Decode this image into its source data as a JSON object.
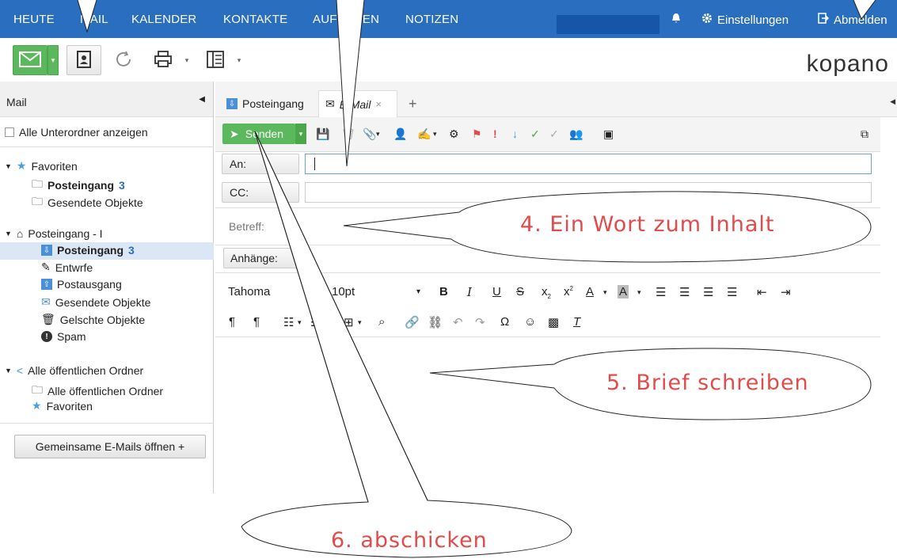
{
  "topnav": {
    "items": [
      "HEUTE",
      "MAIL",
      "KALENDER",
      "KONTAKTE",
      "AUFGABEN",
      "NOTIZEN"
    ],
    "settings_label": "Einstellungen",
    "logout_label": "Abmelden",
    "bg_color": "#2a6ebf"
  },
  "brand": {
    "logo_text": "kopano"
  },
  "leftpanel": {
    "header": "Mail",
    "show_subfolders": "Alle Unterordner anzeigen",
    "favorites_label": "Favoriten",
    "fav_items": [
      {
        "label": "Posteingang",
        "count": "3"
      },
      {
        "label": "Gesendete Objekte"
      }
    ],
    "mailbox_label": "Posteingang - I",
    "mailbox_items": [
      {
        "label": "Posteingang",
        "count": "3",
        "icon": "inbox-icon"
      },
      {
        "label": "Entwrfe",
        "icon": "pencil-icon"
      },
      {
        "label": "Postausgang",
        "icon": "outbox-icon"
      },
      {
        "label": "Gesendete Objekte",
        "icon": "sent-icon"
      },
      {
        "label": "Gelschte Objekte",
        "icon": "trash-icon"
      },
      {
        "label": "Spam",
        "icon": "spam-icon"
      }
    ],
    "public_label": "Alle öffentlichen Ordner",
    "public_items": [
      {
        "label": "Alle öffentlichen Ordner"
      },
      {
        "label": "Favoriten"
      }
    ],
    "shared_button": "Gemeinsame E-Mails öffnen +"
  },
  "tabs": [
    {
      "label": "Posteingang",
      "icon": "inbox-icon"
    },
    {
      "label": "E-Mail",
      "icon": "mail-icon",
      "active": true
    }
  ],
  "compose": {
    "send_label": "Senden",
    "to_label": "An:",
    "cc_label": "CC:",
    "subject_label": "Betreff:",
    "attachments_label": "Anhänge:",
    "font_name": "Tahoma",
    "font_size": "10pt"
  },
  "annotations": {
    "a4": "4. Ein Wort zum Inhalt",
    "a5": "5. Brief schreiben",
    "a6": "6. abschicken",
    "color": "#e24b4b"
  }
}
